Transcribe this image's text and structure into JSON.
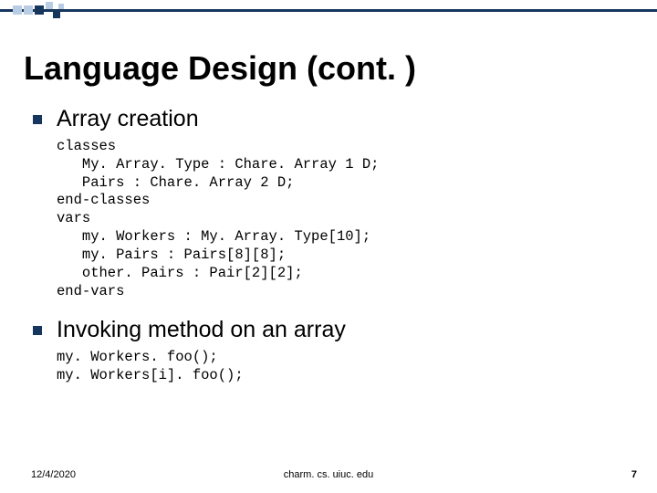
{
  "title": "Language Design (cont. )",
  "points": [
    {
      "label": "Array creation",
      "code": "classes\n   My. Array. Type : Chare. Array 1 D;\n   Pairs : Chare. Array 2 D;\nend-classes\nvars\n   my. Workers : My. Array. Type[10];\n   my. Pairs : Pairs[8][8];\n   other. Pairs : Pair[2][2];\nend-vars"
    },
    {
      "label": "Invoking method on an array",
      "code": "my. Workers. foo();\nmy. Workers[i]. foo();"
    }
  ],
  "footer": {
    "date": "12/4/2020",
    "center": "charm. cs. uiuc. edu",
    "page": "7"
  }
}
